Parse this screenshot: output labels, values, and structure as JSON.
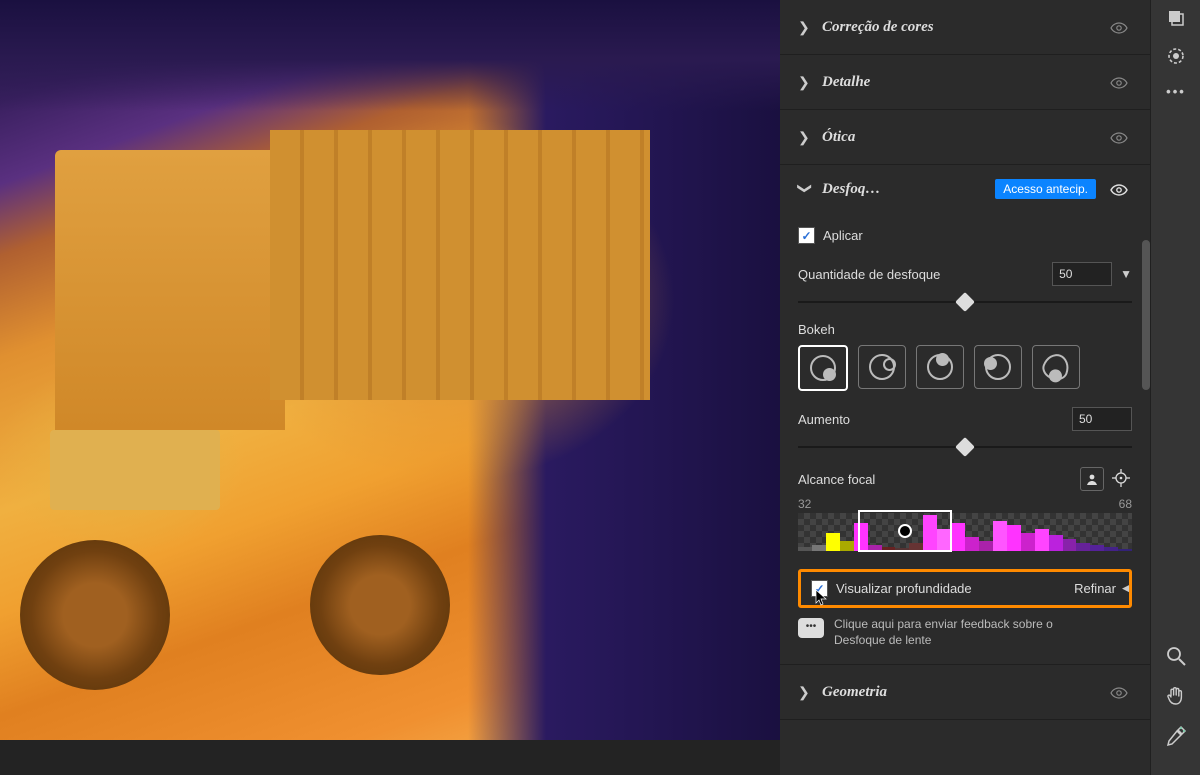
{
  "sections": {
    "s0": "Correção de cores",
    "s1": "Detalhe",
    "s2": "Ótica",
    "s3": "Desfoq…",
    "s4": "Geometria"
  },
  "blur": {
    "badge": "Acesso antecip.",
    "apply": "Aplicar",
    "amount_label": "Quantidade de desfoque",
    "amount_value": "50",
    "bokeh_label": "Bokeh",
    "boost_label": "Aumento",
    "boost_value": "50",
    "focal_label": "Alcance focal",
    "focal_min": "32",
    "focal_max": "68",
    "viz_depth": "Visualizar profundidade",
    "refine": "Refinar",
    "feedback": "Clique aqui para enviar feedback sobre o Desfoque de lente"
  },
  "histogram": [
    4,
    6,
    18,
    10,
    28,
    6,
    4,
    3,
    8,
    36,
    22,
    28,
    14,
    10,
    30,
    26,
    18,
    22,
    16,
    12,
    8,
    6,
    4,
    2
  ],
  "hist_colors": [
    "#555",
    "#777",
    "#ff0",
    "#aa0",
    "#f3f",
    "#a2a",
    "#622",
    "#533",
    "#633",
    "#f4f",
    "#f6f",
    "#f3f",
    "#c2c",
    "#a2a",
    "#f5f",
    "#f3f",
    "#c2c",
    "#f4f",
    "#b2d",
    "#82a",
    "#629",
    "#529",
    "#428",
    "#327"
  ]
}
